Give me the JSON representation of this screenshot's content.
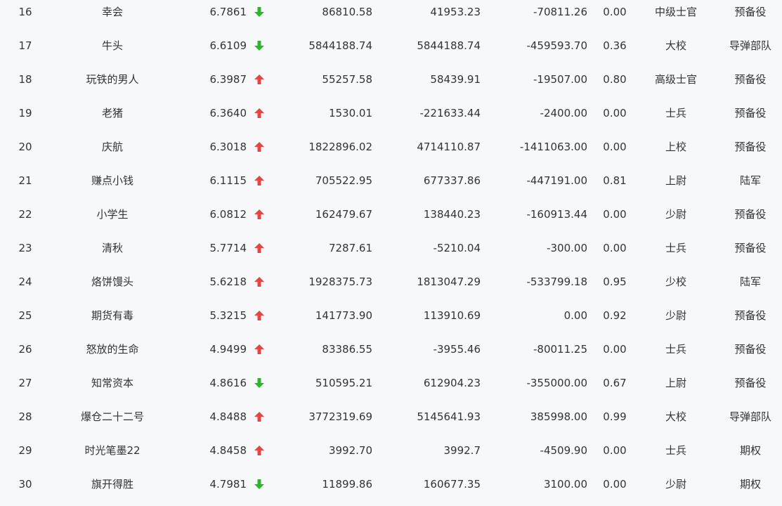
{
  "colors": {
    "up": "#e64545",
    "down": "#2db52d"
  },
  "rows": [
    {
      "rank": "16",
      "name": "幸会",
      "score": "6.7861",
      "trend": "down",
      "v1": "86810.58",
      "v2": "41953.23",
      "v3": "-70811.26",
      "ratio": "0.00",
      "title": "中级士官",
      "group": "预备役"
    },
    {
      "rank": "17",
      "name": "牛头",
      "score": "6.6109",
      "trend": "down",
      "v1": "5844188.74",
      "v2": "5844188.74",
      "v3": "-459593.70",
      "ratio": "0.36",
      "title": "大校",
      "group": "导弹部队"
    },
    {
      "rank": "18",
      "name": "玩铁的男人",
      "score": "6.3987",
      "trend": "up",
      "v1": "55257.58",
      "v2": "58439.91",
      "v3": "-19507.00",
      "ratio": "0.80",
      "title": "高级士官",
      "group": "预备役"
    },
    {
      "rank": "19",
      "name": "老猪",
      "score": "6.3640",
      "trend": "up",
      "v1": "1530.01",
      "v2": "-221633.44",
      "v3": "-2400.00",
      "ratio": "0.00",
      "title": "士兵",
      "group": "预备役"
    },
    {
      "rank": "20",
      "name": "庆航",
      "score": "6.3018",
      "trend": "up",
      "v1": "1822896.02",
      "v2": "4714110.87",
      "v3": "-1411063.00",
      "ratio": "0.00",
      "title": "上校",
      "group": "预备役"
    },
    {
      "rank": "21",
      "name": "赚点小钱",
      "score": "6.1115",
      "trend": "up",
      "v1": "705522.95",
      "v2": "677337.86",
      "v3": "-447191.00",
      "ratio": "0.81",
      "title": "上尉",
      "group": "陆军"
    },
    {
      "rank": "22",
      "name": "小学生",
      "score": "6.0812",
      "trend": "up",
      "v1": "162479.67",
      "v2": "138440.23",
      "v3": "-160913.44",
      "ratio": "0.00",
      "title": "少尉",
      "group": "预备役"
    },
    {
      "rank": "23",
      "name": "清秋",
      "score": "5.7714",
      "trend": "up",
      "v1": "7287.61",
      "v2": "-5210.04",
      "v3": "-300.00",
      "ratio": "0.00",
      "title": "士兵",
      "group": "预备役"
    },
    {
      "rank": "24",
      "name": "烙饼馒头",
      "score": "5.6218",
      "trend": "up",
      "v1": "1928375.73",
      "v2": "1813047.29",
      "v3": "-533799.18",
      "ratio": "0.95",
      "title": "少校",
      "group": "陆军"
    },
    {
      "rank": "25",
      "name": "期货有毒",
      "score": "5.3215",
      "trend": "up",
      "v1": "141773.90",
      "v2": "113910.69",
      "v3": "0.00",
      "ratio": "0.92",
      "title": "少尉",
      "group": "预备役"
    },
    {
      "rank": "26",
      "name": "怒放的生命",
      "score": "4.9499",
      "trend": "up",
      "v1": "83386.55",
      "v2": "-3955.46",
      "v3": "-80011.25",
      "ratio": "0.00",
      "title": "士兵",
      "group": "预备役"
    },
    {
      "rank": "27",
      "name": "知常资本",
      "score": "4.8616",
      "trend": "down",
      "v1": "510595.21",
      "v2": "612904.23",
      "v3": "-355000.00",
      "ratio": "0.67",
      "title": "上尉",
      "group": "预备役"
    },
    {
      "rank": "28",
      "name": "爆仓二十二号",
      "score": "4.8488",
      "trend": "up",
      "v1": "3772319.69",
      "v2": "5145641.93",
      "v3": "385998.00",
      "ratio": "0.99",
      "title": "大校",
      "group": "导弹部队"
    },
    {
      "rank": "29",
      "name": "时光笔墨22",
      "score": "4.8458",
      "trend": "up",
      "v1": "3992.70",
      "v2": "3992.7",
      "v3": "-4509.90",
      "ratio": "0.00",
      "title": "士兵",
      "group": "期权"
    },
    {
      "rank": "30",
      "name": "旗开得胜",
      "score": "4.7981",
      "trend": "down",
      "v1": "11899.86",
      "v2": "160677.35",
      "v3": "3100.00",
      "ratio": "0.00",
      "title": "少尉",
      "group": "期权"
    }
  ]
}
